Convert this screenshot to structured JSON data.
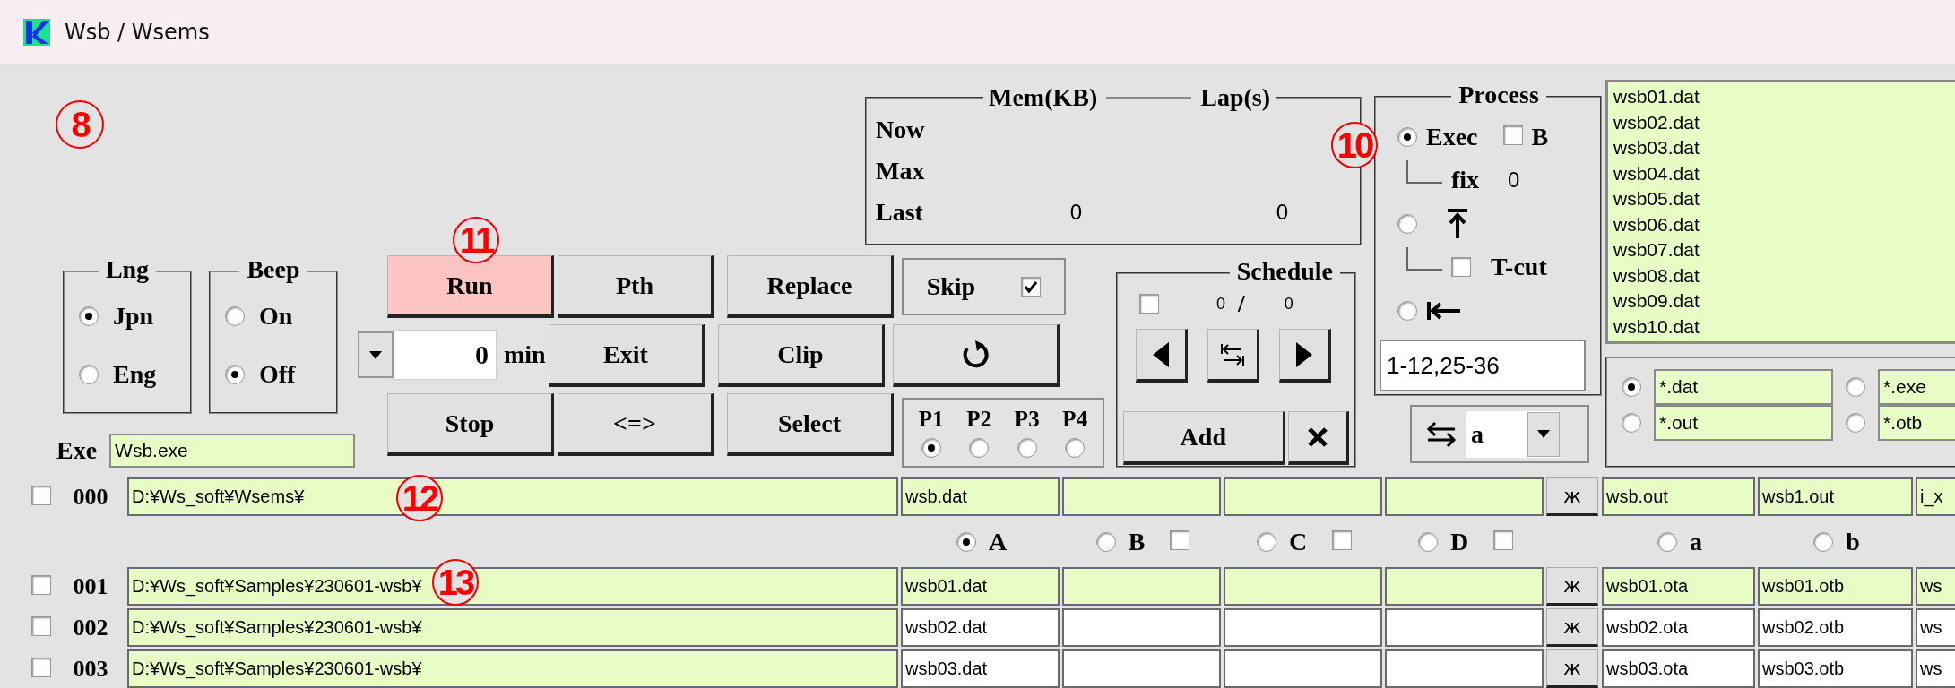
{
  "window": {
    "title": "Wsb / Wsems"
  },
  "annotations": [
    {
      "label": "8"
    },
    {
      "label": "10"
    },
    {
      "label": "11"
    },
    {
      "label": "12"
    },
    {
      "label": "13"
    }
  ],
  "lng": {
    "title": "Lng",
    "options": [
      {
        "label": "Jpn",
        "selected": true
      },
      {
        "label": "Eng",
        "selected": false
      }
    ]
  },
  "beep": {
    "title": "Beep",
    "options": [
      {
        "label": "On",
        "selected": false
      },
      {
        "label": "Off",
        "selected": true
      }
    ]
  },
  "buttons": [
    {
      "label": "Run",
      "highlighted": true
    },
    {
      "label": "Pth",
      "highlighted": false
    },
    {
      "label": "Replace",
      "highlighted": false
    },
    {
      "label": "Exit",
      "highlighted": false
    },
    {
      "label": "Clip",
      "highlighted": false
    },
    {
      "label": "Stop",
      "highlighted": false
    },
    {
      "label": "<=>",
      "highlighted": false
    },
    {
      "label": "Select",
      "highlighted": false
    }
  ],
  "interval": {
    "value": "0",
    "unit": "min"
  },
  "skip": {
    "label": "Skip",
    "checked": true
  },
  "profiles": [
    {
      "label": "P1",
      "selected": true
    },
    {
      "label": "P2",
      "selected": false
    },
    {
      "label": "P3",
      "selected": false
    },
    {
      "label": "P4",
      "selected": false
    }
  ],
  "monitor": {
    "mem_title": "Mem(KB)",
    "lap_title": "Lap(s)",
    "rows": [
      {
        "label": "Now"
      },
      {
        "label": "Max"
      },
      {
        "label": "Last",
        "mem": "0",
        "lap": "0"
      }
    ]
  },
  "schedule": {
    "title": "Schedule",
    "checked": false,
    "current": "0",
    "separator": "/",
    "total": "0",
    "add": "Add"
  },
  "process": {
    "title": "Process",
    "modes": [
      {
        "kind": "exec",
        "label": "Exec",
        "selected": true
      },
      {
        "kind": "top",
        "selected": false
      },
      {
        "kind": "head",
        "selected": false
      }
    ],
    "b": {
      "label": "B",
      "checked": false
    },
    "fix": {
      "label": "fix",
      "value": "0"
    },
    "tcut": {
      "label": "T-cut",
      "checked": false
    },
    "range": "1-12,25-36"
  },
  "swap": {
    "value": "a"
  },
  "files": [
    "wsb01.dat",
    "wsb02.dat",
    "wsb03.dat",
    "wsb04.dat",
    "wsb05.dat",
    "wsb06.dat",
    "wsb07.dat",
    "wsb08.dat",
    "wsb09.dat",
    "wsb10.dat"
  ],
  "filters": [
    {
      "pattern": "*.dat",
      "selected": true
    },
    {
      "pattern": "*.exe",
      "selected": false
    },
    {
      "pattern": "*.out",
      "selected": false
    },
    {
      "pattern": "*.otb",
      "selected": false
    }
  ],
  "exe": {
    "label": "Exe",
    "value": "Wsb.exe"
  },
  "table": {
    "rows": [
      {
        "number": "000",
        "checked": false,
        "highlighted": true,
        "path": "D:¥Ws_soft¥Wsems¥",
        "input_a": "wsb.dat",
        "button": "ж",
        "output_a": "wsb.out",
        "output_b": "wsb1.out",
        "output_c": "i_x"
      },
      {
        "number": "001",
        "checked": false,
        "highlighted": true,
        "path": "D:¥Ws_soft¥Samples¥230601-wsb¥",
        "input_a": "wsb01.dat",
        "button": "ж",
        "output_a": "wsb01.ota",
        "output_b": "wsb01.otb",
        "output_c": "ws"
      },
      {
        "number": "002",
        "checked": false,
        "highlighted": false,
        "path": "D:¥Ws_soft¥Samples¥230601-wsb¥",
        "input_a": "wsb02.dat",
        "button": "ж",
        "output_a": "wsb02.ota",
        "output_b": "wsb02.otb",
        "output_c": "ws"
      },
      {
        "number": "003",
        "checked": false,
        "highlighted": false,
        "path": "D:¥Ws_soft¥Samples¥230601-wsb¥",
        "input_a": "wsb03.dat",
        "button": "ж",
        "output_a": "wsb03.ota",
        "output_b": "wsb03.otb",
        "output_c": "ws"
      }
    ],
    "slots": [
      {
        "label": "A",
        "selected": true
      },
      {
        "label": "B",
        "selected": false,
        "checked": false
      },
      {
        "label": "C",
        "selected": false,
        "checked": false
      },
      {
        "label": "D",
        "selected": false,
        "checked": false
      },
      {
        "label": "a",
        "selected": false
      },
      {
        "label": "b",
        "selected": false
      }
    ]
  }
}
